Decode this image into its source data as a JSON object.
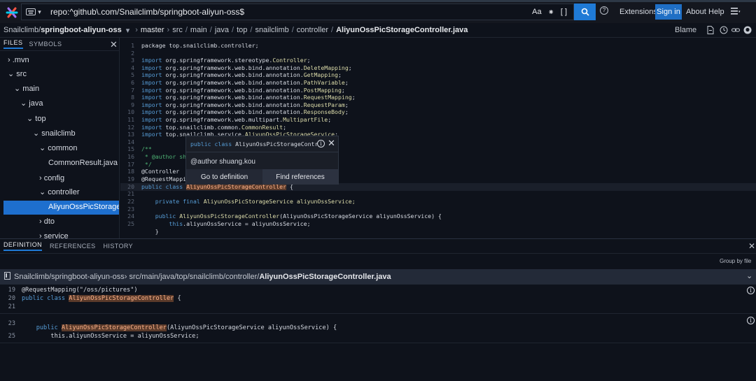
{
  "search": {
    "query": "repo:^github\\.com/Snailclimb/springboot-aliyun-oss$",
    "case_toggle": "Aa",
    "regex_toggle": "[ ]"
  },
  "nav": {
    "extensions": "Extensions",
    "signin": "Sign in",
    "about": "About",
    "help": "Help"
  },
  "breadcrumb": {
    "repo_owner": "Snailclimb/",
    "repo_name": "springboot-aliyun-oss",
    "branch": "master",
    "path": [
      "src",
      "main",
      "java",
      "top",
      "snailclimb",
      "controller"
    ],
    "file": "AliyunOssPicStorageController.java",
    "blame": "Blame"
  },
  "sidebar": {
    "tabs": {
      "files": "FILES",
      "symbols": "SYMBOLS"
    },
    "items": [
      ".mvn",
      "src",
      "main",
      "java",
      "top",
      "snailclimb",
      "common",
      "CommonResult.java",
      "config",
      "controller",
      "AliyunOssPicStorageController.java",
      "dto",
      "service"
    ]
  },
  "code": {
    "line_numbers": [
      "1",
      "2",
      "3",
      "4",
      "5",
      "6",
      "7",
      "8",
      "9",
      "10",
      "11",
      "12",
      "13",
      "14",
      "15",
      "16",
      "17",
      "18",
      "19",
      "20",
      "21",
      "22",
      "23",
      "24",
      "25"
    ],
    "l1": "package top.snailclimb.controller;",
    "imp": "import",
    "l3a": " org.springframework.stereotype.",
    "l3b": "Controller",
    "l3c": ";",
    "l4a": " org.springframework.web.bind.annotation.",
    "l4b": "DeleteMapping",
    "l4c": ";",
    "l5a": " org.springframework.web.bind.annotation.",
    "l5b": "GetMapping",
    "l5c": ";",
    "l6a": " org.springframework.web.bind.annotation.",
    "l6b": "PathVariable",
    "l6c": ";",
    "l7a": " org.springframework.web.bind.annotation.",
    "l7b": "PostMapping",
    "l7c": ";",
    "l8a": " org.springframework.web.bind.annotation.",
    "l8b": "RequestMapping",
    "l8c": ";",
    "l9a": " org.springframework.web.bind.annotation.",
    "l9b": "RequestParam",
    "l9c": ";",
    "l10a": " org.springframework.web.bind.annotation.",
    "l10b": "ResponseBody",
    "l10c": ";",
    "l11a": " org.springframework.web.multipart.",
    "l11b": "MultipartFile",
    "l11c": ";",
    "l12a": " top.snailclimb.common.",
    "l12b": "CommonResult",
    "l12c": ";",
    "l13a": " top.snailclimb.service.",
    "l13b": "AliyunOssPicStorageService",
    "l13c": ";",
    "l15": "/**",
    "l16": " * @author sh",
    "l17": " */",
    "l18": "@Controller",
    "l19": "@RequestMappi",
    "l20a": "public class",
    "l20b": "AliyunOssPicStorageController",
    "l20c": " {",
    "l22a": "    private final",
    "l22b": " AliyunOssPicStorageService aliyunOssService;",
    "l24a": "    public",
    "l24b": " AliyunOssPicStorageController",
    "l24c": "(AliyunOssPicStorageService aliyunOssService) {",
    "l25a": "        this",
    "l25b": ".aliyunOssService = aliyunOssService;",
    "l26": "    }"
  },
  "hover": {
    "signature_kw": "public class",
    "signature_name": " AliyunOssPicStorageContr",
    "doc": "@author shuang.kou",
    "go_to_definition": "Go to definition",
    "find_references": "Find references"
  },
  "panel": {
    "tabs": [
      "DEFINITION",
      "REFERENCES",
      "HISTORY"
    ],
    "group_by_file": "Group by file",
    "file_repo": "Snailclimb/springboot-aliyun-oss",
    "file_dir": " › src/main/java/top/snailclimb/controller/",
    "file_name": "AliyunOssPicStorageController.java",
    "refs": {
      "n19": "19",
      "t19": "@RequestMapping(\"/oss/pictures\")",
      "n20": "20",
      "t20a": "public class ",
      "t20b": "AliyunOssPicStorageController",
      "t20c": " {",
      "n21": "21",
      "n23": "23",
      "n24": "24",
      "t24a": "    public ",
      "t24b": "AliyunOssPicStorageController",
      "t24c": "(AliyunOssPicStorageService aliyunOssService) {",
      "n25": "25",
      "t25": "        this.aliyunOssService = aliyunOssService;"
    }
  },
  "colors": {
    "accent": "#1f7ad6",
    "selection": "#1e6fce",
    "highlight_bg": "#5a3a2a",
    "highlight_fg": "#ffb38a"
  }
}
